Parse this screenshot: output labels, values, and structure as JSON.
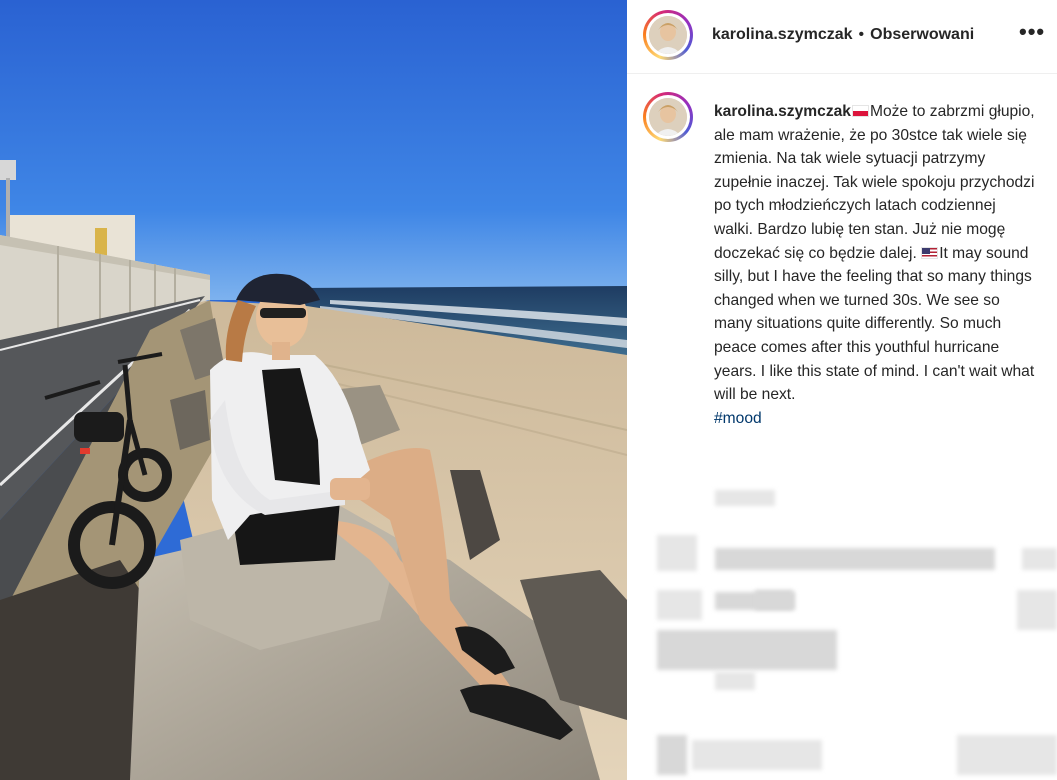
{
  "post": {
    "username": "karolina.szymczak",
    "separator": "•",
    "follow_state": "Obserwowani",
    "more_label": "•••",
    "caption": {
      "username": "karolina.szymczak",
      "polish_text": "Może to zabrzmi głupio, ale mam wrażenie, że po 30stce tak wiele się zmienia. Na tak wiele sytuacji patrzymy zupełnie inaczej. Tak wiele spokoju przychodzi po tych młodzieńczych latach codziennej walki. Bardzo lubię ten stan. Już nie mogę doczekać się co będzie dalej.",
      "english_text": "It may sound silly, but I have the feeling that so many things changed when we turned 30s. We see so many situations quite differently. So much peace comes after this youthful hurricane years. I like this state of mind. I can't wait what will be next.",
      "hashtag": "#mood"
    }
  },
  "colors": {
    "sky": "#2e6bd6",
    "sea": "#1f3f66",
    "sand": "#d9c6a8",
    "rock": "#b9b2a6",
    "hashtag": "#00376b",
    "text": "#262626"
  },
  "icons": {
    "more": "more-options-icon",
    "flag_pl": "poland-flag-icon",
    "flag_us": "usa-flag-icon"
  }
}
